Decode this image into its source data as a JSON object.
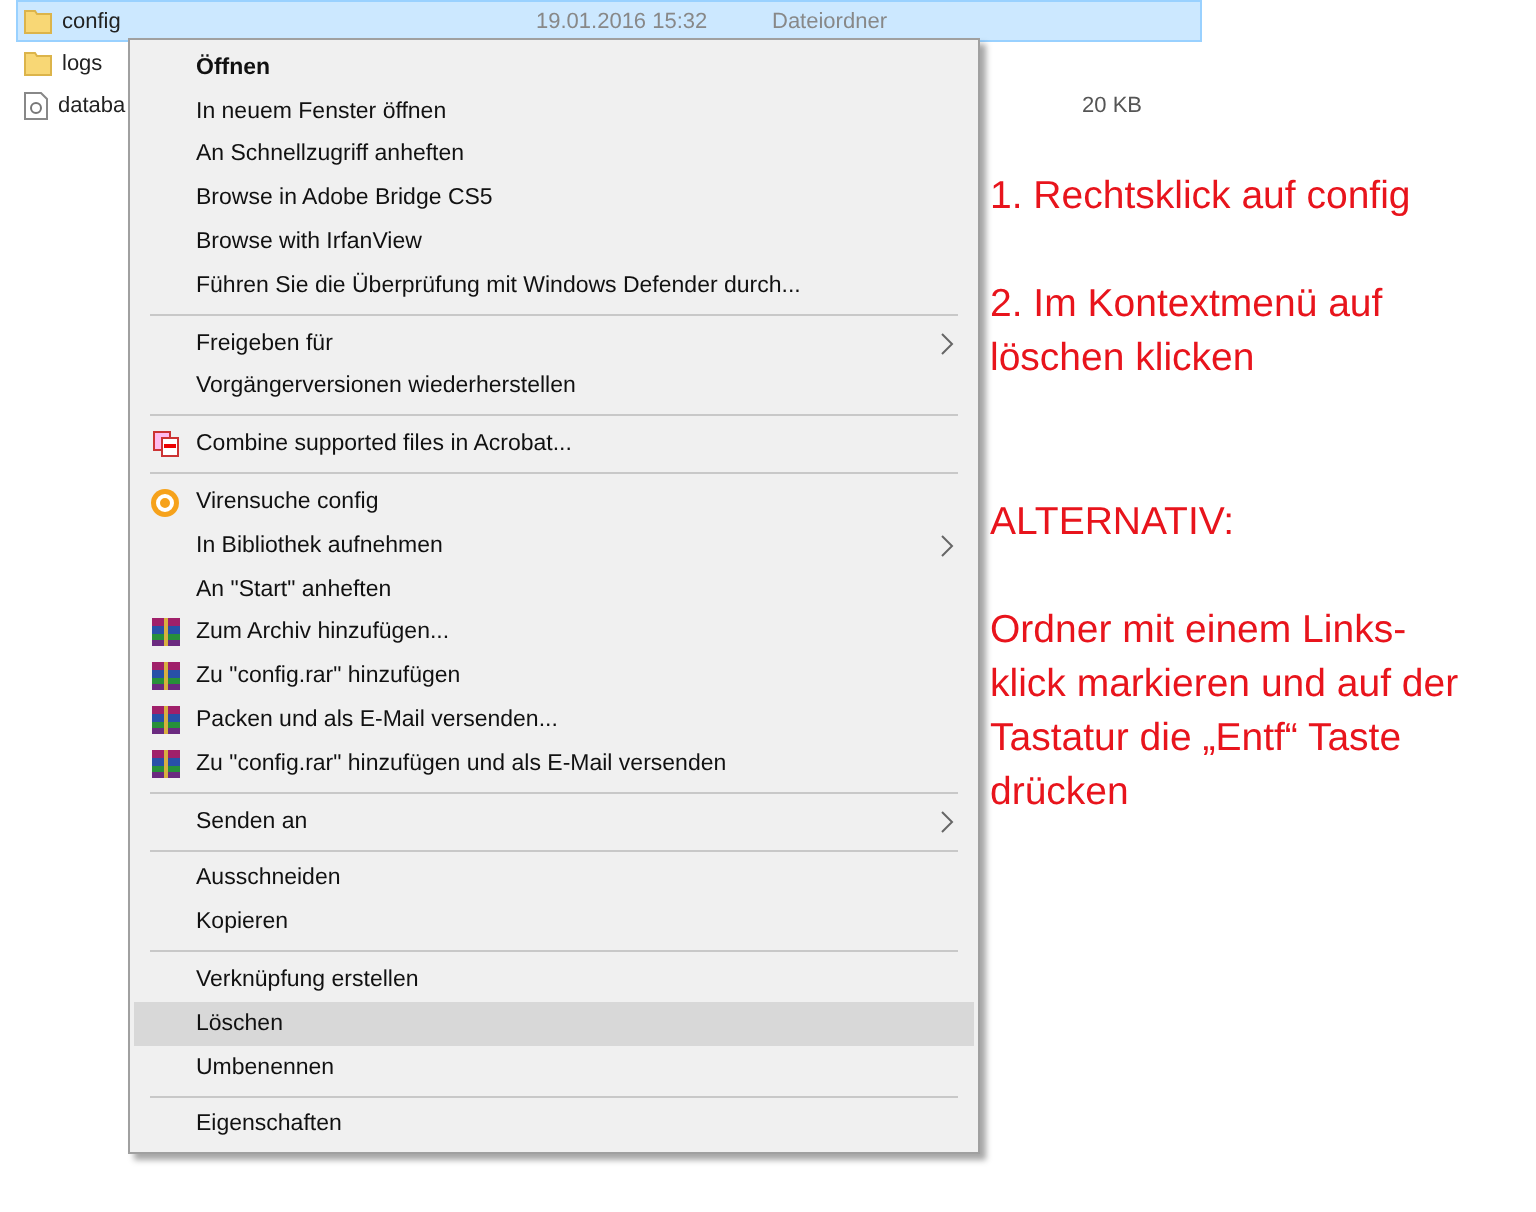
{
  "files": [
    {
      "name": "config",
      "date": "19.01.2016 15:32",
      "type": "Dateiordner",
      "kind": "folder",
      "selected": true
    },
    {
      "name": "logs",
      "kind": "folder",
      "selected": false
    },
    {
      "name": "databa",
      "size": "20 KB",
      "kind": "file",
      "selected": false
    }
  ],
  "context_menu": {
    "groups": [
      [
        {
          "label": "Öffnen",
          "kind": "plain",
          "bold": true,
          "submenu": false,
          "selected": false
        },
        {
          "label": "In neuem Fenster öffnen",
          "kind": "plain",
          "bold": false,
          "submenu": false,
          "selected": false
        },
        {
          "label": "An Schnellzugriff anheften",
          "kind": "plain",
          "bold": false,
          "submenu": false,
          "selected": false
        },
        {
          "label": "Browse in Adobe Bridge CS5",
          "kind": "plain",
          "bold": false,
          "submenu": false,
          "selected": false
        },
        {
          "label": "Browse with IrfanView",
          "kind": "plain",
          "bold": false,
          "submenu": false,
          "selected": false
        },
        {
          "label": "Führen Sie die Überprüfung mit Windows Defender durch...",
          "kind": "plain",
          "bold": false,
          "submenu": false,
          "selected": false
        }
      ],
      [
        {
          "label": "Freigeben für",
          "kind": "plain",
          "bold": false,
          "submenu": true,
          "selected": false
        },
        {
          "label": "Vorgängerversionen wiederherstellen",
          "kind": "plain",
          "bold": false,
          "submenu": false,
          "selected": false
        }
      ],
      [
        {
          "label": "Combine supported files in Acrobat...",
          "kind": "pdf",
          "bold": false,
          "submenu": false,
          "selected": false
        }
      ],
      [
        {
          "label": "Virensuche config",
          "kind": "scan",
          "bold": false,
          "submenu": false,
          "selected": false
        },
        {
          "label": "In Bibliothek aufnehmen",
          "kind": "plain",
          "bold": false,
          "submenu": true,
          "selected": false
        },
        {
          "label": "An \"Start\" anheften",
          "kind": "plain",
          "bold": false,
          "submenu": false,
          "selected": false
        },
        {
          "label": "Zum Archiv hinzufügen...",
          "kind": "archive",
          "bold": false,
          "submenu": false,
          "selected": false
        },
        {
          "label": "Zu \"config.rar\" hinzufügen",
          "kind": "archive",
          "bold": false,
          "submenu": false,
          "selected": false
        },
        {
          "label": "Packen und als E-Mail versenden...",
          "kind": "archive",
          "bold": false,
          "submenu": false,
          "selected": false
        },
        {
          "label": "Zu \"config.rar\" hinzufügen und als E-Mail versenden",
          "kind": "archive",
          "bold": false,
          "submenu": false,
          "selected": false
        }
      ],
      [
        {
          "label": "Senden an",
          "kind": "plain",
          "bold": false,
          "submenu": true,
          "selected": false
        }
      ],
      [
        {
          "label": "Ausschneiden",
          "kind": "plain",
          "bold": false,
          "submenu": false,
          "selected": false
        },
        {
          "label": "Kopieren",
          "kind": "plain",
          "bold": false,
          "submenu": false,
          "selected": false
        }
      ],
      [
        {
          "label": "Verknüpfung erstellen",
          "kind": "plain",
          "bold": false,
          "submenu": false,
          "selected": false
        },
        {
          "label": "Löschen",
          "kind": "plain",
          "bold": false,
          "submenu": false,
          "selected": true
        },
        {
          "label": "Umbenennen",
          "kind": "plain",
          "bold": false,
          "submenu": false,
          "selected": false
        }
      ],
      [
        {
          "label": "Eigenschaften",
          "kind": "plain",
          "bold": false,
          "submenu": false,
          "selected": false
        }
      ]
    ]
  },
  "annotations": [
    {
      "text": "1. Rechtsklick auf config"
    },
    {
      "text": "2. Im Kontextmenü auf\n löschen klicken"
    },
    {
      "text": "ALTERNATIV:"
    },
    {
      "text": "Ordner mit einem Links-\nklick markieren und auf der\nTastatur die „Entf“ Taste\ndrücken"
    }
  ]
}
